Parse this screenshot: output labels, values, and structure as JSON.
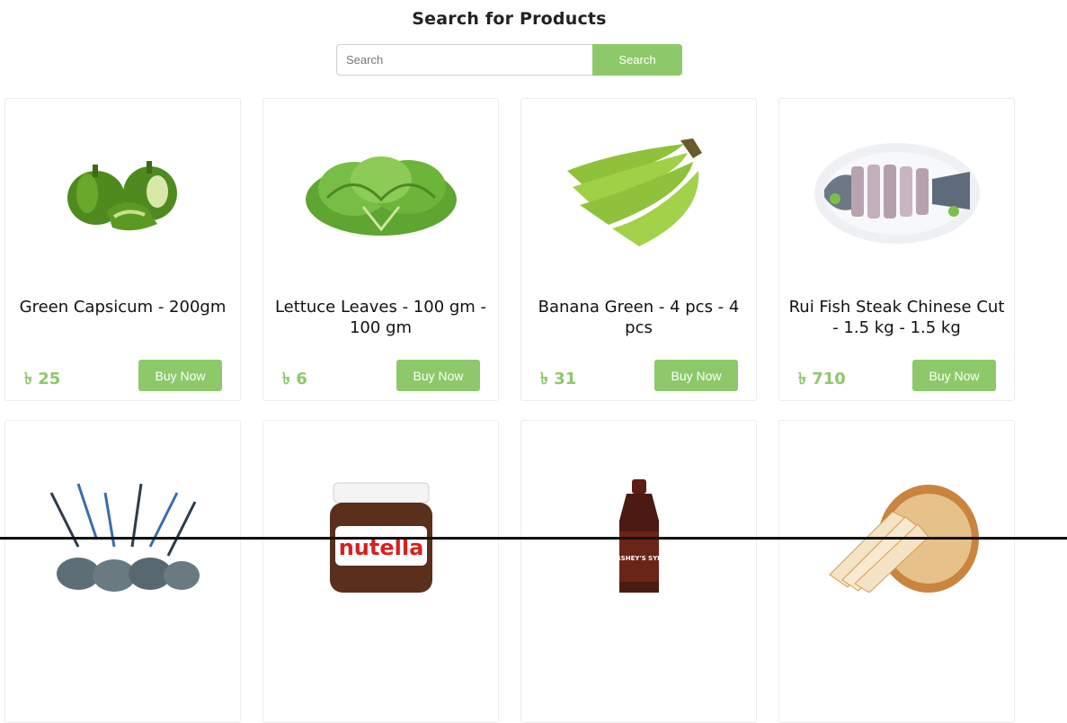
{
  "header": {
    "title": "Search for Products"
  },
  "search": {
    "placeholder": "Search",
    "value": "",
    "button_label": "Search"
  },
  "products": [
    {
      "name": "Green Capsicum - 200gm",
      "price": "৳ 25",
      "button": "Buy Now",
      "image": "green-capsicum"
    },
    {
      "name": "Lettuce Leaves - 100 gm - 100 gm",
      "price": "৳ 6",
      "button": "Buy Now",
      "image": "lettuce"
    },
    {
      "name": "Banana Green - 4 pcs - 4 pcs",
      "price": "৳ 31",
      "button": "Buy Now",
      "image": "green-banana"
    },
    {
      "name": "Rui Fish Steak Chinese Cut - 1.5 kg - 1.5 kg",
      "price": "৳ 710",
      "button": "Buy Now",
      "image": "fish-steak"
    },
    {
      "name": "",
      "price": "",
      "button": "",
      "image": "prawns"
    },
    {
      "name": "",
      "price": "",
      "button": "",
      "image": "nutella-jar",
      "image_text": "nutella"
    },
    {
      "name": "",
      "price": "",
      "button": "",
      "image": "hersheys-syrup",
      "image_text": "HERSHEY'S SYRUP"
    },
    {
      "name": "",
      "price": "",
      "button": "",
      "image": "bread-loaf"
    }
  ],
  "colors": {
    "accent": "#8dc96a"
  }
}
